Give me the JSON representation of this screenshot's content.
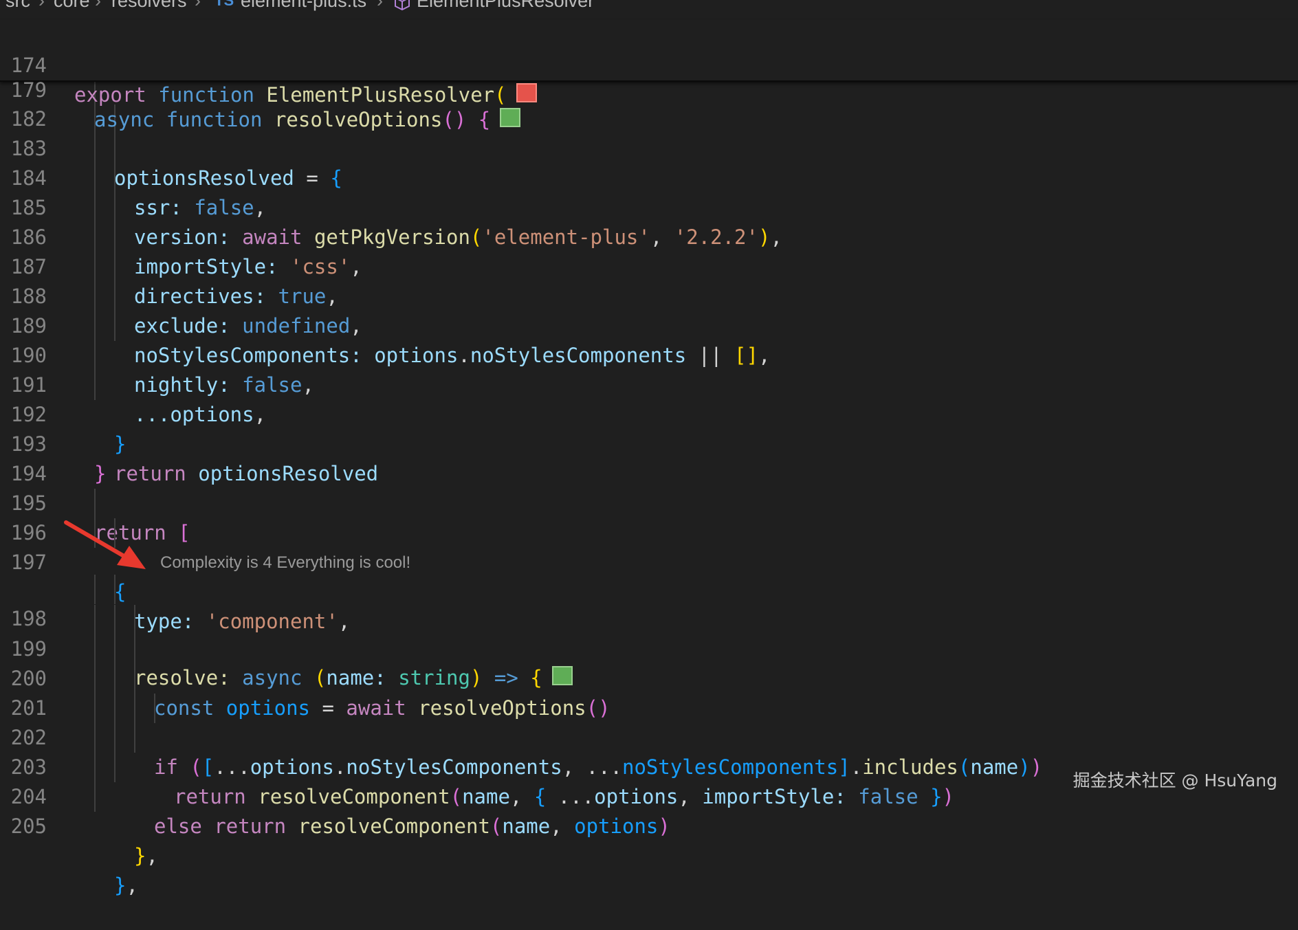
{
  "breadcrumb": [
    "src",
    "core",
    "resolvers",
    "element-plus.ts",
    "ElementPlusResolver"
  ],
  "breadcrumb_icons": [
    "ts-file-icon",
    "symbol-class-icon"
  ],
  "sticky_lines": [
    {
      "num": "174",
      "color_marker": "#e5534b"
    },
    {
      "num": "179",
      "color_marker": "#5fad56"
    }
  ],
  "lines": [
    {
      "num": "182"
    },
    {
      "num": "183"
    },
    {
      "num": "184"
    },
    {
      "num": "185"
    },
    {
      "num": "186"
    },
    {
      "num": "187"
    },
    {
      "num": "188"
    },
    {
      "num": "189"
    },
    {
      "num": "190"
    },
    {
      "num": "191"
    },
    {
      "num": "192"
    },
    {
      "num": "193"
    },
    {
      "num": "194"
    },
    {
      "num": "195"
    },
    {
      "num": "196"
    },
    {
      "num": "197"
    },
    {
      "num": "198"
    },
    {
      "num": "199"
    },
    {
      "num": "200"
    },
    {
      "num": "201"
    },
    {
      "num": "202"
    },
    {
      "num": "203"
    },
    {
      "num": "204"
    },
    {
      "num": "205"
    }
  ],
  "code": {
    "export_kw": "export",
    "function_kw": "function",
    "resolver_name": "ElementPlusResolver",
    "async_kw": "async",
    "resolve_options_fn": "resolveOptions",
    "options_resolved": "optionsResolved",
    "ssr_key": "ssr:",
    "false_val": "false",
    "version_key": "version:",
    "await_kw": "await",
    "get_pkg_version_fn": "getPkgVersion",
    "pkg_name_str": "'element-plus'",
    "pkg_version_str": "'2.2.2'",
    "import_style_key": "importStyle:",
    "css_str": "'css'",
    "directives_key": "directives:",
    "true_val": "true",
    "exclude_key": "exclude:",
    "undefined_val": "undefined",
    "no_styles_key": "noStylesComponents:",
    "options_var": "options",
    "no_styles_prop": "noStylesComponents",
    "nightly_key": "nightly:",
    "spread_options": "...options",
    "return_kw": "return",
    "type_key": "type:",
    "component_str": "'component'",
    "resolve_key": "resolve:",
    "name_param": "name",
    "string_type": "string",
    "arrow": "=>",
    "const_kw": "const",
    "if_kw": "if",
    "includes_fn": "includes",
    "resolve_component_fn": "resolveComponent",
    "else_kw": "else"
  },
  "codelens": "Complexity is 4 Everything is cool!",
  "annotation_color": "#e8392e",
  "watermark": "掘金技术社区 @ HsuYang"
}
